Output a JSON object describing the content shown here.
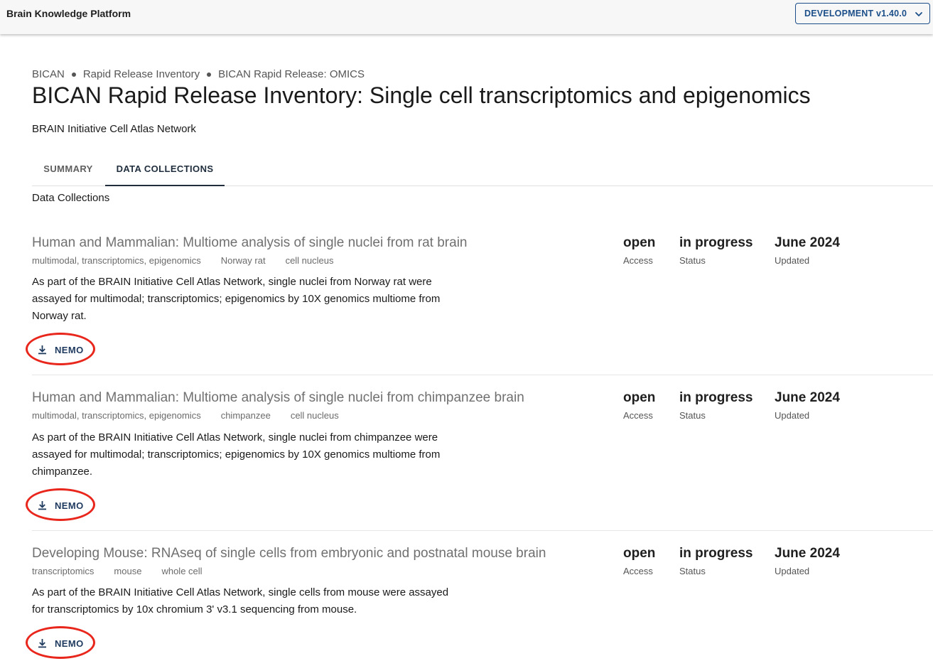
{
  "app": {
    "title": "Brain Knowledge Platform",
    "environment": "DEVELOPMENT v1.40.0"
  },
  "breadcrumb": [
    "BICAN",
    "Rapid Release Inventory",
    "BICAN Rapid Release: OMICS"
  ],
  "page": {
    "title": "BICAN Rapid Release Inventory: Single cell transcriptomics and epigenomics",
    "subtitle": "BRAIN Initiative Cell Atlas Network"
  },
  "tabs": [
    {
      "label": "SUMMARY",
      "active": false
    },
    {
      "label": "DATA COLLECTIONS",
      "active": true
    }
  ],
  "section_label": "Data Collections",
  "labels": {
    "access": "Access",
    "status": "Status",
    "updated": "Updated"
  },
  "collections": [
    {
      "title": "Human and Mammalian: Multiome analysis of single nuclei from rat brain",
      "tags": [
        "multimodal, transcriptomics, epigenomics",
        "Norway rat",
        "cell nucleus"
      ],
      "description": "As part of the BRAIN Initiative Cell Atlas Network, single nuclei from Norway rat were assayed for multimodal; transcriptomics; epigenomics by 10X genomics multiome from Norway rat.",
      "access": "open",
      "status": "in progress",
      "updated": "June 2024",
      "download_label": "NEMO"
    },
    {
      "title": "Human and Mammalian: Multiome analysis of single nuclei from chimpanzee brain",
      "tags": [
        "multimodal, transcriptomics, epigenomics",
        "chimpanzee",
        "cell nucleus"
      ],
      "description": "As part of the BRAIN Initiative Cell Atlas Network, single nuclei from chimpanzee were assayed for multimodal; transcriptomics; epigenomics by 10X genomics multiome from chimpanzee.",
      "access": "open",
      "status": "in progress",
      "updated": "June 2024",
      "download_label": "NEMO"
    },
    {
      "title": "Developing Mouse: RNAseq of single cells from embryonic and postnatal mouse brain",
      "tags": [
        "transcriptomics",
        "mouse",
        "whole cell"
      ],
      "description": "As part of the BRAIN Initiative Cell Atlas Network, single cells from mouse were assayed for transcriptomics by 10x chromium 3' v3.1 sequencing from mouse.",
      "access": "open",
      "status": "in progress",
      "updated": "June 2024",
      "download_label": "NEMO"
    }
  ],
  "colors": {
    "accent": "#1c4f8a",
    "annotation_ring": "#e8261b",
    "active_tab": "#1f2d3d"
  },
  "icons": {
    "download": "download-icon",
    "dropdown": "chevron-down-icon"
  }
}
